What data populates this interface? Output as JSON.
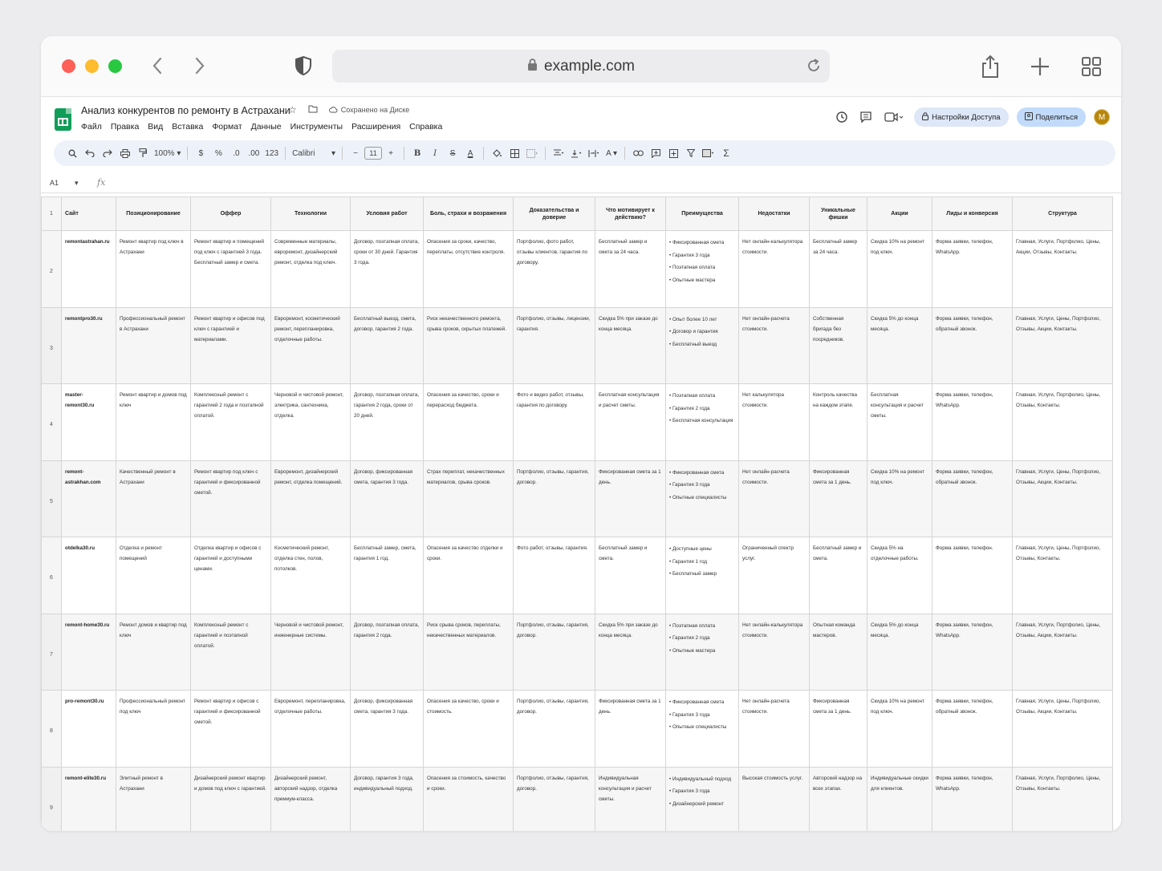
{
  "browser": {
    "url": "example.com"
  },
  "sheet": {
    "title": "Анализ конкурентов по ремонту в Астрахани",
    "saved_status": "Сохранено на Диске",
    "menu": [
      "Файл",
      "Правка",
      "Вид",
      "Вставка",
      "Формат",
      "Данные",
      "Инструменты",
      "Расширения",
      "Справка"
    ],
    "access_button": "Настройки Доступа",
    "share_button": "Поделиться",
    "avatar_letter": "M",
    "zoom": "100%",
    "currency": "$",
    "percent": "%",
    "dec_less": ".0",
    "dec_more": ".00",
    "number_format": "123",
    "font": "Calibri",
    "font_size": "11",
    "cell_ref": "A1",
    "fx_label": "fx",
    "row_header_1": "1"
  },
  "columns": [
    "Сайт",
    "Позиционирование",
    "Оффер",
    "Технологии",
    "Условия работ",
    "Боль, страхи и возражения",
    "Доказательства и доверие",
    "Что мотивирует к действию?",
    "Преимущества",
    "Недостатки",
    "Уникальные фишки",
    "Акции",
    "Лиды и конверсия",
    "Структура"
  ],
  "rows": [
    {
      "n": "2",
      "cells": [
        "remontastrahan.ru",
        "Ремонт квартир под ключ в Астрахани",
        "Ремонт квартир и помещений под ключ с гарантией 3 года. Бесплатный замер и смета.",
        "Современные материалы, евроремонт, дизайнерский ремонт, отделка под ключ.",
        "Договор, поэтапная оплата, сроки от 30 дней. Гарантия 3 года.",
        "Опасения за сроки, качество, переплаты, отсутствие контроля.",
        "Портфолио, фото работ, отзывы клиентов, гарантия по договору.",
        "Бесплатный замер и смета за 24 часа.",
        "• Фиксированная смета\n• Гарантия 3 года\n• Поэтапная оплата\n• Опытные мастера",
        "Нет онлайн-калькулятора стоимости.",
        "Бесплатный замер за 24 часа.",
        "Скидка 10% на ремонт под ключ.",
        "Форма заявки, телефон, WhatsApp.",
        "Главная, Услуги, Портфолио, Цены, Акции, Отзывы, Контакты."
      ]
    },
    {
      "n": "3",
      "cells": [
        "remontpro30.ru",
        "Профессиональный ремонт в Астрахани",
        "Ремонт квартир и офисов под ключ с гарантией и материалами.",
        "Евроремонт, косметический ремонт, перепланировка, отделочные работы.",
        "Бесплатный выезд, смета, договор, гарантия 2 года.",
        "Риск некачественного ремонта, срыва сроков, скрытых платежей.",
        "Портфолио, отзывы, лицензии, гарантия.",
        "Скидка 5% при заказе до конца месяца.",
        "• Опыт более 10 лет\n• Договор и гарантия\n• Бесплатный выезд",
        "Нет онлайн-расчета стоимости.",
        "Собственная бригада без посредников.",
        "Скидка 5% до конца месяца.",
        "Форма заявки, телефон, обратный звонок.",
        "Главная, Услуги, Цены, Портфолио, Отзывы, Акции, Контакты."
      ]
    },
    {
      "n": "4",
      "cells": [
        "master-remont30.ru",
        "Ремонт квартир и домов под ключ",
        "Комплексный ремонт с гарантией 2 года и поэтапной оплатой.",
        "Черновой и чистовой ремонт, электрика, сантехника, отделка.",
        "Договор, поэтапная оплата, гарантия 2 года, сроки от 20 дней.",
        "Опасения за качество, сроки и перерасход бюджета.",
        "Фото и видео работ, отзывы, гарантия по договору.",
        "Бесплатная консультация и расчет сметы.",
        "• Поэтапная оплата\n• Гарантия 2 года\n• Бесплатная консультация",
        "Нет калькулятора стоимости.",
        "Контроль качества на каждом этапе.",
        "Бесплатная консультация и расчет сметы.",
        "Форма заявки, телефон, WhatsApp.",
        "Главная, Услуги, Портфолио, Цены, Отзывы, Контакты."
      ]
    },
    {
      "n": "5",
      "cells": [
        "remont-astrakhan.com",
        "Качественный ремонт в Астрахани",
        "Ремонт квартир под ключ с гарантией и фиксированной сметой.",
        "Евроремонт, дизайнерский ремонт, отделка помещений.",
        "Договор, фиксированная смета, гарантия 3 года.",
        "Страх переплат, некачественных материалов, срыва сроков.",
        "Портфолио, отзывы, гарантия, договор.",
        "Фиксированная смета за 1 день.",
        "• Фиксированная смета\n• Гарантия 3 года\n• Опытные специалисты",
        "Нет онлайн-расчета стоимости.",
        "Фиксированная смета за 1 день.",
        "Скидка 10% на ремонт под ключ.",
        "Форма заявки, телефон, обратный звонок.",
        "Главная, Услуги, Цены, Портфолио, Отзывы, Акции, Контакты."
      ]
    },
    {
      "n": "6",
      "cells": [
        "otdelka30.ru",
        "Отделка и ремонт помещений",
        "Отделка квартир и офисов с гарантией и доступными ценами.",
        "Косметический ремонт, отделка стен, полов, потолков.",
        "Бесплатный замер, смета, гарантия 1 год.",
        "Опасения за качество отделки и сроки.",
        "Фото работ, отзывы, гарантия.",
        "Бесплатный замер и смета.",
        "• Доступные цены\n• Гарантия 1 год\n• Бесплатный замер",
        "Ограниченный спектр услуг.",
        "Бесплатный замер и смета.",
        "Скидка 5% на отделочные работы.",
        "Форма заявки, телефон.",
        "Главная, Услуги, Цены, Портфолио, Отзывы, Контакты."
      ]
    },
    {
      "n": "7",
      "cells": [
        "remont-home30.ru",
        "Ремонт домов и квартир под ключ",
        "Комплексный ремонт с гарантией и поэтапной оплатой.",
        "Черновой и чистовой ремонт, инженерные системы.",
        "Договор, поэтапная оплата, гарантия 2 года.",
        "Риск срыва сроков, переплаты, некачественных материалов.",
        "Портфолио, отзывы, гарантия, договор.",
        "Скидка 5% при заказе до конца месяца.",
        "• Поэтапная оплата\n• Гарантия 2 года\n• Опытные мастера",
        "Нет онлайн-калькулятора стоимости.",
        "Опытная команда мастеров.",
        "Скидка 5% до конца месяца.",
        "Форма заявки, телефон, WhatsApp.",
        "Главная, Услуги, Портфолио, Цены, Отзывы, Акции, Контакты."
      ]
    },
    {
      "n": "8",
      "cells": [
        "pro-remont30.ru",
        "Профессиональный ремонт под ключ",
        "Ремонт квартир и офисов с гарантией и фиксированной сметой.",
        "Евроремонт, перепланировка, отделочные работы.",
        "Договор, фиксированная смета, гарантия 3 года.",
        "Опасения за качество, сроки и стоимость.",
        "Портфолио, отзывы, гарантия, договор.",
        "Фиксированная смета за 1 день.",
        "• Фиксированная смета\n• Гарантия 3 года\n• Опытные специалисты",
        "Нет онлайн-расчета стоимости.",
        "Фиксированная смета за 1 день.",
        "Скидка 10% на ремонт под ключ.",
        "Форма заявки, телефон, обратный звонок.",
        "Главная, Услуги, Цены, Портфолио, Отзывы, Акции, Контакты."
      ]
    },
    {
      "n": "9",
      "cells": [
        "remont-elite30.ru",
        "Элитный ремонт в Астрахани",
        "Дизайнерский ремонт квартир и домов под ключ с гарантией.",
        "Дизайнерский ремонт, авторский надзор, отделка премиум-класса.",
        "Договор, гарантия 3 года, индивидуальный подход.",
        "Опасения за стоимость, качество и сроки.",
        "Портфолио, отзывы, гарантия, договор.",
        "Индивидуальная консультация и расчет сметы.",
        "• Индивидуальный подход\n• Гарантия 3 года\n• Дизайнерский ремонт",
        "Высокая стоимость услуг.",
        "Авторский надзор на всех этапах.",
        "Индивидуальные скидки для клиентов.",
        "Форма заявки, телефон, WhatsApp.",
        "Главная, Услуги, Портфолио, Цены, Отзывы, Контакты."
      ]
    }
  ],
  "icons": {
    "back": "chevron-left-icon",
    "forward": "chevron-right-icon",
    "privacy": "shield-icon",
    "lock": "lock-icon",
    "reload": "reload-icon",
    "share": "share-icon",
    "new_tab": "plus-icon",
    "tabs": "tab-grid-icon"
  }
}
